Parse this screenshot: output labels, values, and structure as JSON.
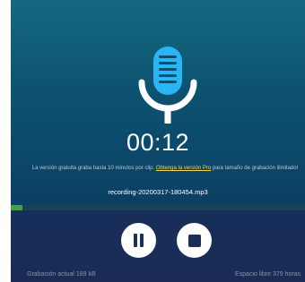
{
  "recorder": {
    "timer": "00:12",
    "notice": {
      "before_link": "La versión gratuita graba hasta 10 minutos por clip. ",
      "link": "Obtenga la versión Pro",
      "after_link": " para tamaño de grabación ilimitado!"
    },
    "filename": "recording-20200317-180454.mp3",
    "progress_fraction": 0.04
  },
  "controls": {
    "pause_icon": "pause-icon",
    "stop_icon": "stop-icon"
  },
  "status": {
    "current_size": "Grabación actual 189 kB",
    "free_space": "Espacio libre 379 horas"
  },
  "colors": {
    "background_top": "#14697f",
    "background_bottom": "#1a2c55",
    "mic_body": "#29b6f6",
    "mic_stand": "#ffffff",
    "link": "#f4d74a",
    "progress": "#43a047"
  },
  "icons": {
    "microphone": "microphone-icon"
  }
}
